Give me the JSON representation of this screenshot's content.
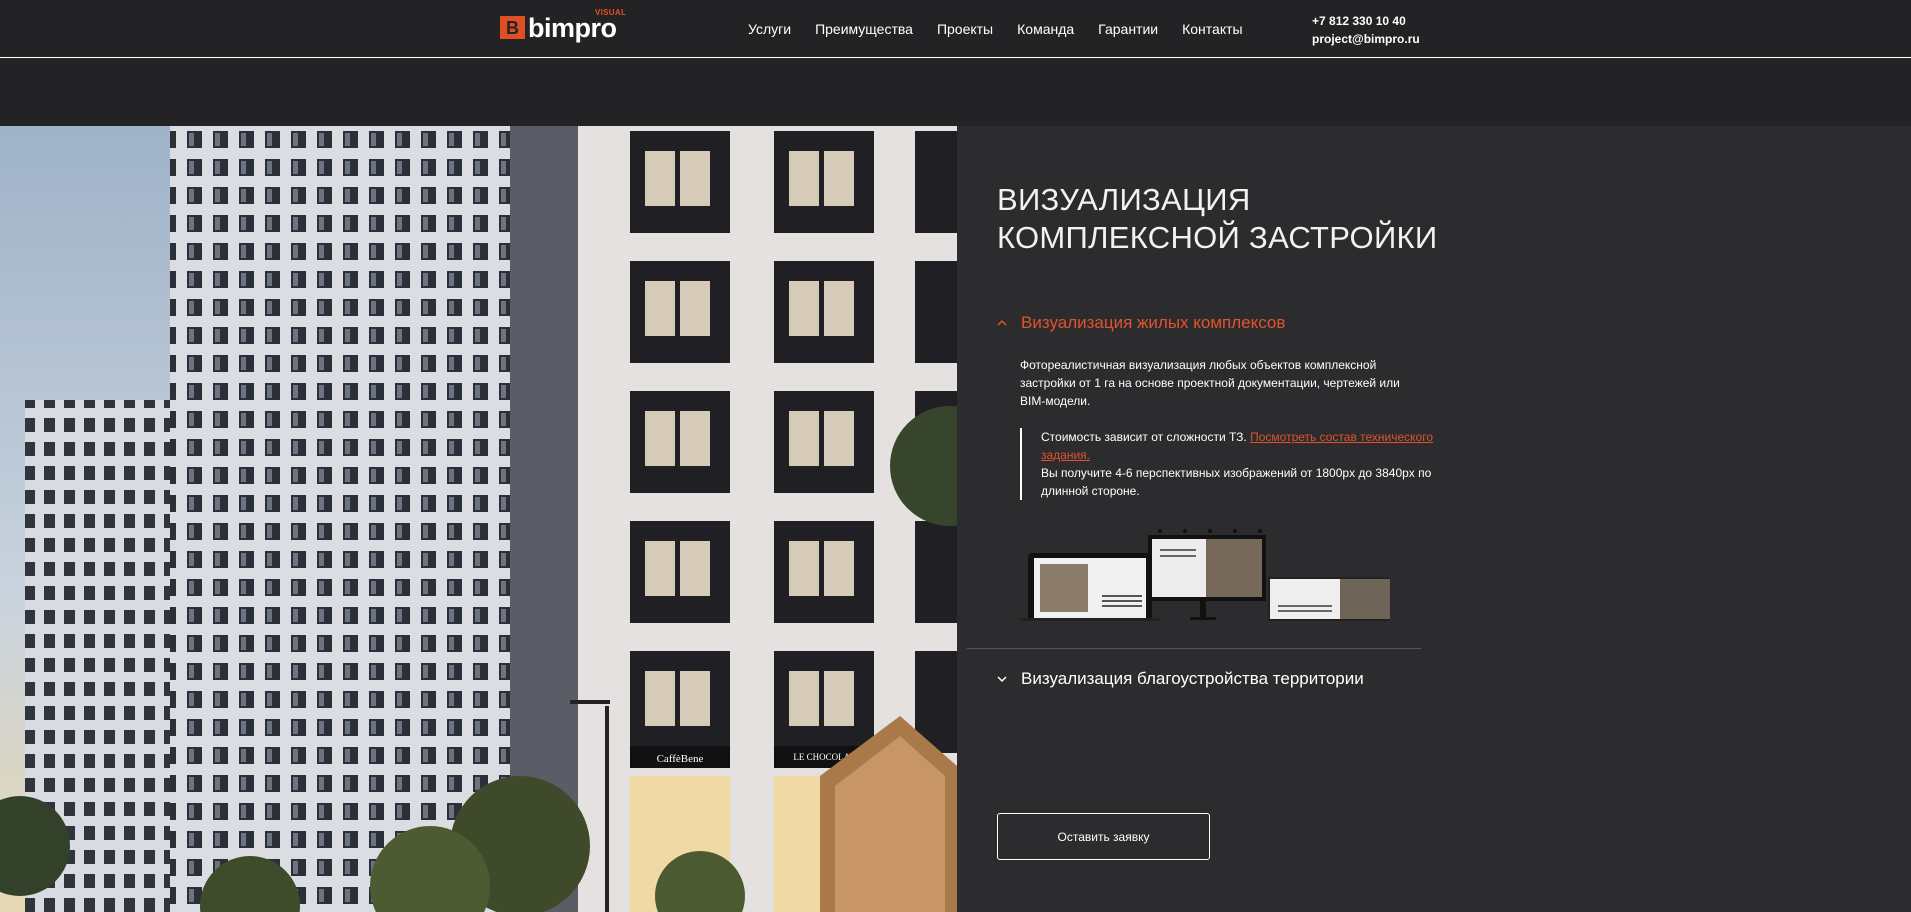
{
  "header": {
    "logo_mark": "B",
    "logo_text": "bimpro",
    "logo_tag": "VISUAL",
    "nav": [
      "Услуги",
      "Преимущества",
      "Проекты",
      "Команда",
      "Гарантии",
      "Контакты"
    ],
    "phone": "+7 812 330 10 40",
    "email": "project@bimpro.ru"
  },
  "hero": {
    "title_line1": "ВИЗУАЛИЗАЦИЯ",
    "title_line2": "КОМПЛЕКСНОЙ ЗАСТРОЙКИ"
  },
  "photo": {
    "shop1": "CaffèBene",
    "shop2": "LE CHOCOLAT"
  },
  "accordion": {
    "item1": {
      "title": "Визуализация жилых комплексов",
      "description": "Фотореалистичная визуализация любых объектов комплексной застройки от 1 га на основе проектной документации, чертежей или BIM-модели.",
      "cost_text": "Стоимость зависит от сложности ТЗ.",
      "link_text": "Посмотреть состав технического задания.",
      "result_text": "Вы получите 4-6 перспективных изображений от 1800px до 3840px по длинной стороне."
    },
    "item2": {
      "title": "Визуализация благоустройства территории"
    }
  },
  "cta": {
    "label": "Оставить заявку"
  },
  "colors": {
    "accent": "#e0532b",
    "background": "#2c2c2f",
    "header": "#232325"
  }
}
